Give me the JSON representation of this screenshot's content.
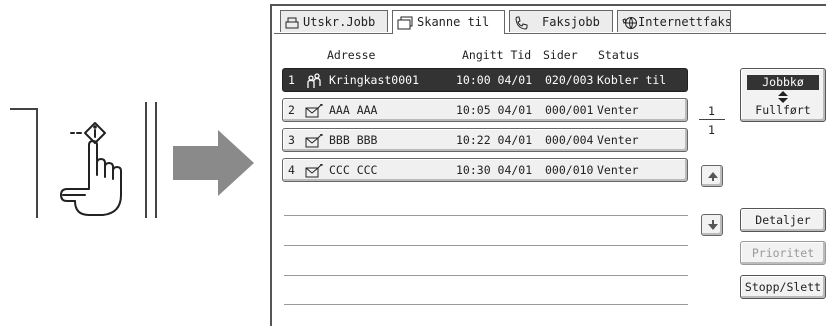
{
  "tabs": [
    {
      "label": "Utskr.Jobb",
      "icon": "printer-icon"
    },
    {
      "label": "Skanne til",
      "icon": "scanner-icon"
    },
    {
      "label": "Faksjobb",
      "icon": "fax-icon"
    },
    {
      "label": "Internettfaks",
      "icon": "internet-fax-icon"
    }
  ],
  "columns": {
    "address": "Adresse",
    "time": "Angitt Tid",
    "pages": "Sider",
    "status": "Status"
  },
  "jobs": [
    {
      "num": "1",
      "address": "Kringkast0001",
      "time": "10:00 04/01",
      "pages": "020/003",
      "status": "Kobler til",
      "icon": "broadcast-icon"
    },
    {
      "num": "2",
      "address": "AAA AAA",
      "time": "10:05 04/01",
      "pages": "000/001",
      "status": "Venter",
      "icon": "email-icon"
    },
    {
      "num": "3",
      "address": "BBB BBB",
      "time": "10:22 04/01",
      "pages": "000/004",
      "status": "Venter",
      "icon": "email-icon"
    },
    {
      "num": "4",
      "address": "CCC CCC",
      "time": "10:30 04/01",
      "pages": "000/010",
      "status": "Venter",
      "icon": "email-icon"
    }
  ],
  "page_indicator": {
    "current": "1",
    "total": "1"
  },
  "queue_toggle": {
    "top": "Jobbkø",
    "bottom": "Fullført"
  },
  "buttons": {
    "details": "Detaljer",
    "priority": "Prioritet",
    "stop_delete": "Stopp/Slett"
  },
  "colors": {
    "selected_row": "#333333",
    "arrow": "#8a8a8a"
  }
}
